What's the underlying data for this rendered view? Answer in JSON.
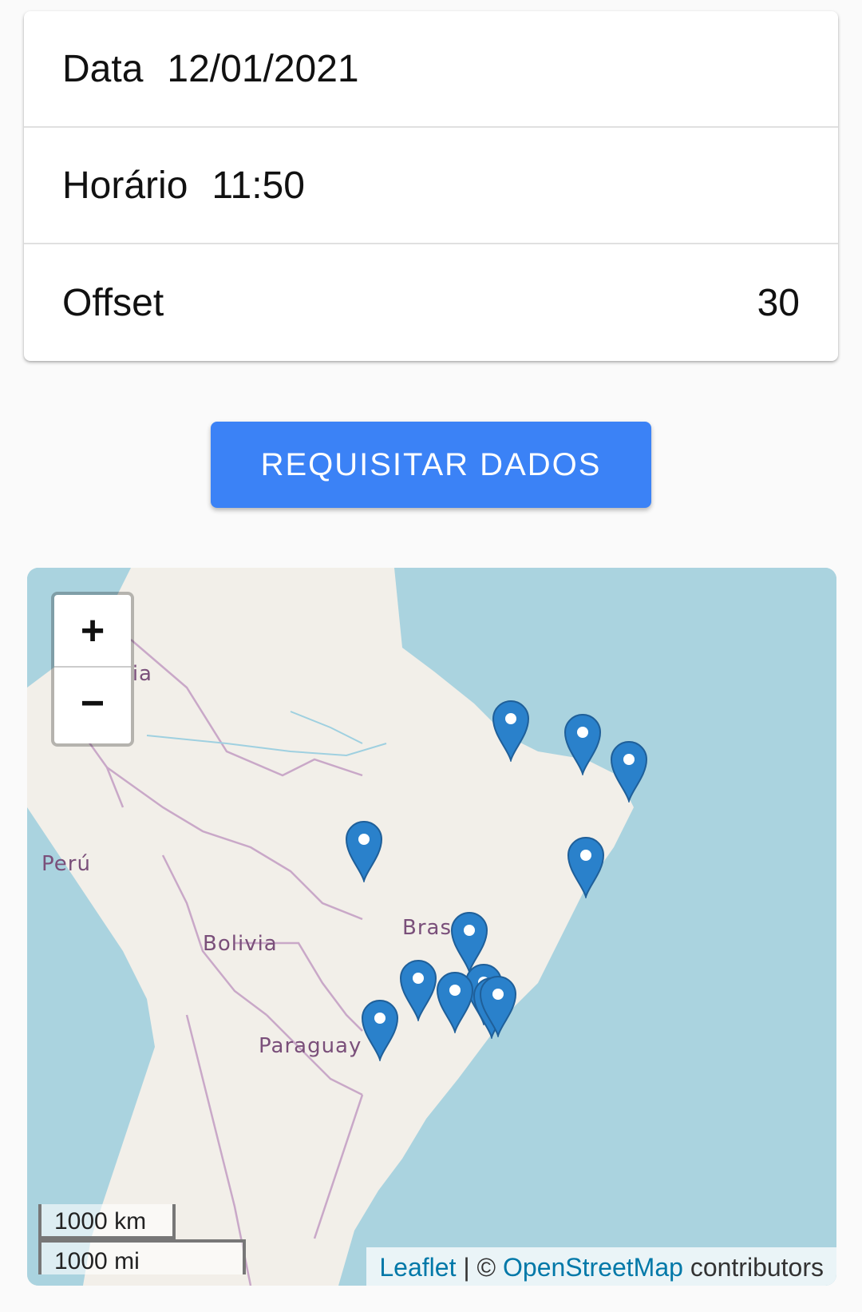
{
  "form": {
    "date_label": "Data",
    "date_value": "12/01/2021",
    "time_label": "Horário",
    "time_value": "11:50",
    "offset_label": "Offset",
    "offset_value": "30"
  },
  "request_button_label": "REQUISITAR DADOS",
  "map": {
    "zoom_in": "+",
    "zoom_out": "−",
    "scale_km": "1000 km",
    "scale_mi": "1000 mi",
    "attribution": {
      "leaflet": "Leaflet",
      "separator": " | © ",
      "osm": "OpenStreetMap",
      "suffix": " contributors"
    },
    "country_labels": {
      "colombia": "mbia",
      "peru": "Perú",
      "bolivia": "Bolivia",
      "brasil": "Bras",
      "paraguay": "Paraguay"
    },
    "marker_count": 12,
    "colors": {
      "water": "#aad3df",
      "land": "#f2efe9",
      "marker": "#2a81cb"
    }
  }
}
